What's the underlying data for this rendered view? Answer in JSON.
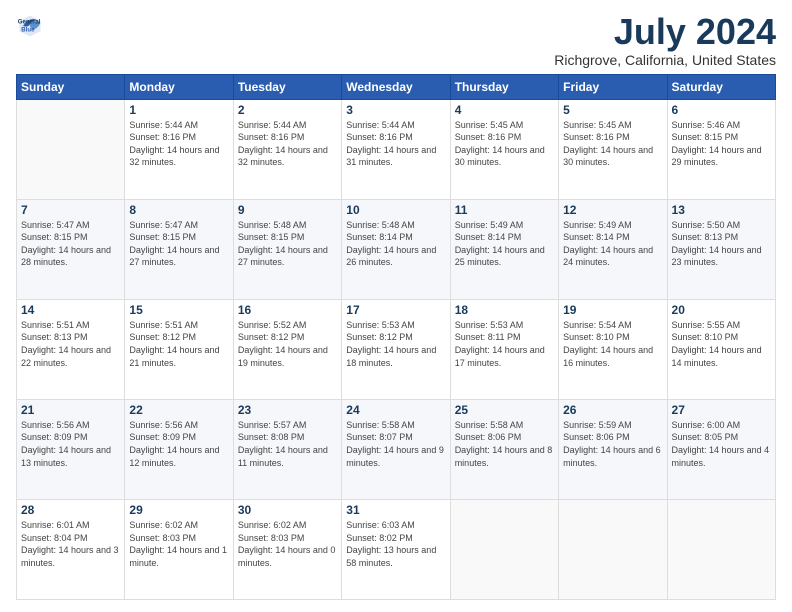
{
  "app": {
    "logo_line1": "General",
    "logo_line2": "Blue",
    "title": "July 2024",
    "subtitle": "Richgrove, California, United States"
  },
  "calendar": {
    "headers": [
      "Sunday",
      "Monday",
      "Tuesday",
      "Wednesday",
      "Thursday",
      "Friday",
      "Saturday"
    ],
    "rows": [
      [
        {
          "day": "",
          "sunrise": "",
          "sunset": "",
          "daylight": ""
        },
        {
          "day": "1",
          "sunrise": "Sunrise: 5:44 AM",
          "sunset": "Sunset: 8:16 PM",
          "daylight": "Daylight: 14 hours and 32 minutes."
        },
        {
          "day": "2",
          "sunrise": "Sunrise: 5:44 AM",
          "sunset": "Sunset: 8:16 PM",
          "daylight": "Daylight: 14 hours and 32 minutes."
        },
        {
          "day": "3",
          "sunrise": "Sunrise: 5:44 AM",
          "sunset": "Sunset: 8:16 PM",
          "daylight": "Daylight: 14 hours and 31 minutes."
        },
        {
          "day": "4",
          "sunrise": "Sunrise: 5:45 AM",
          "sunset": "Sunset: 8:16 PM",
          "daylight": "Daylight: 14 hours and 30 minutes."
        },
        {
          "day": "5",
          "sunrise": "Sunrise: 5:45 AM",
          "sunset": "Sunset: 8:16 PM",
          "daylight": "Daylight: 14 hours and 30 minutes."
        },
        {
          "day": "6",
          "sunrise": "Sunrise: 5:46 AM",
          "sunset": "Sunset: 8:15 PM",
          "daylight": "Daylight: 14 hours and 29 minutes."
        }
      ],
      [
        {
          "day": "7",
          "sunrise": "Sunrise: 5:47 AM",
          "sunset": "Sunset: 8:15 PM",
          "daylight": "Daylight: 14 hours and 28 minutes."
        },
        {
          "day": "8",
          "sunrise": "Sunrise: 5:47 AM",
          "sunset": "Sunset: 8:15 PM",
          "daylight": "Daylight: 14 hours and 27 minutes."
        },
        {
          "day": "9",
          "sunrise": "Sunrise: 5:48 AM",
          "sunset": "Sunset: 8:15 PM",
          "daylight": "Daylight: 14 hours and 27 minutes."
        },
        {
          "day": "10",
          "sunrise": "Sunrise: 5:48 AM",
          "sunset": "Sunset: 8:14 PM",
          "daylight": "Daylight: 14 hours and 26 minutes."
        },
        {
          "day": "11",
          "sunrise": "Sunrise: 5:49 AM",
          "sunset": "Sunset: 8:14 PM",
          "daylight": "Daylight: 14 hours and 25 minutes."
        },
        {
          "day": "12",
          "sunrise": "Sunrise: 5:49 AM",
          "sunset": "Sunset: 8:14 PM",
          "daylight": "Daylight: 14 hours and 24 minutes."
        },
        {
          "day": "13",
          "sunrise": "Sunrise: 5:50 AM",
          "sunset": "Sunset: 8:13 PM",
          "daylight": "Daylight: 14 hours and 23 minutes."
        }
      ],
      [
        {
          "day": "14",
          "sunrise": "Sunrise: 5:51 AM",
          "sunset": "Sunset: 8:13 PM",
          "daylight": "Daylight: 14 hours and 22 minutes."
        },
        {
          "day": "15",
          "sunrise": "Sunrise: 5:51 AM",
          "sunset": "Sunset: 8:12 PM",
          "daylight": "Daylight: 14 hours and 21 minutes."
        },
        {
          "day": "16",
          "sunrise": "Sunrise: 5:52 AM",
          "sunset": "Sunset: 8:12 PM",
          "daylight": "Daylight: 14 hours and 19 minutes."
        },
        {
          "day": "17",
          "sunrise": "Sunrise: 5:53 AM",
          "sunset": "Sunset: 8:12 PM",
          "daylight": "Daylight: 14 hours and 18 minutes."
        },
        {
          "day": "18",
          "sunrise": "Sunrise: 5:53 AM",
          "sunset": "Sunset: 8:11 PM",
          "daylight": "Daylight: 14 hours and 17 minutes."
        },
        {
          "day": "19",
          "sunrise": "Sunrise: 5:54 AM",
          "sunset": "Sunset: 8:10 PM",
          "daylight": "Daylight: 14 hours and 16 minutes."
        },
        {
          "day": "20",
          "sunrise": "Sunrise: 5:55 AM",
          "sunset": "Sunset: 8:10 PM",
          "daylight": "Daylight: 14 hours and 14 minutes."
        }
      ],
      [
        {
          "day": "21",
          "sunrise": "Sunrise: 5:56 AM",
          "sunset": "Sunset: 8:09 PM",
          "daylight": "Daylight: 14 hours and 13 minutes."
        },
        {
          "day": "22",
          "sunrise": "Sunrise: 5:56 AM",
          "sunset": "Sunset: 8:09 PM",
          "daylight": "Daylight: 14 hours and 12 minutes."
        },
        {
          "day": "23",
          "sunrise": "Sunrise: 5:57 AM",
          "sunset": "Sunset: 8:08 PM",
          "daylight": "Daylight: 14 hours and 11 minutes."
        },
        {
          "day": "24",
          "sunrise": "Sunrise: 5:58 AM",
          "sunset": "Sunset: 8:07 PM",
          "daylight": "Daylight: 14 hours and 9 minutes."
        },
        {
          "day": "25",
          "sunrise": "Sunrise: 5:58 AM",
          "sunset": "Sunset: 8:06 PM",
          "daylight": "Daylight: 14 hours and 8 minutes."
        },
        {
          "day": "26",
          "sunrise": "Sunrise: 5:59 AM",
          "sunset": "Sunset: 8:06 PM",
          "daylight": "Daylight: 14 hours and 6 minutes."
        },
        {
          "day": "27",
          "sunrise": "Sunrise: 6:00 AM",
          "sunset": "Sunset: 8:05 PM",
          "daylight": "Daylight: 14 hours and 4 minutes."
        }
      ],
      [
        {
          "day": "28",
          "sunrise": "Sunrise: 6:01 AM",
          "sunset": "Sunset: 8:04 PM",
          "daylight": "Daylight: 14 hours and 3 minutes."
        },
        {
          "day": "29",
          "sunrise": "Sunrise: 6:02 AM",
          "sunset": "Sunset: 8:03 PM",
          "daylight": "Daylight: 14 hours and 1 minute."
        },
        {
          "day": "30",
          "sunrise": "Sunrise: 6:02 AM",
          "sunset": "Sunset: 8:03 PM",
          "daylight": "Daylight: 14 hours and 0 minutes."
        },
        {
          "day": "31",
          "sunrise": "Sunrise: 6:03 AM",
          "sunset": "Sunset: 8:02 PM",
          "daylight": "Daylight: 13 hours and 58 minutes."
        },
        {
          "day": "",
          "sunrise": "",
          "sunset": "",
          "daylight": ""
        },
        {
          "day": "",
          "sunrise": "",
          "sunset": "",
          "daylight": ""
        },
        {
          "day": "",
          "sunrise": "",
          "sunset": "",
          "daylight": ""
        }
      ]
    ]
  }
}
